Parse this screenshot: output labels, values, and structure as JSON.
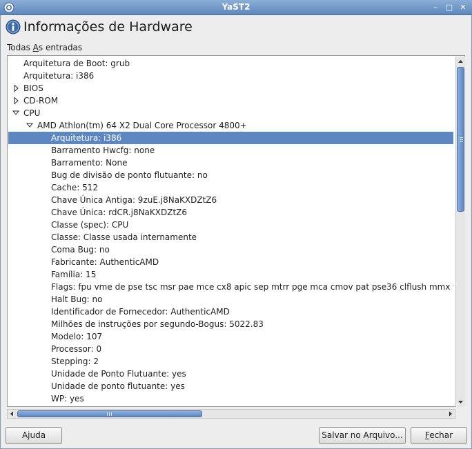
{
  "window": {
    "title": "YaST2",
    "controls": {
      "minimize": "–",
      "maximize": "□",
      "close": "✕"
    }
  },
  "heading": {
    "title": "Informações de Hardware"
  },
  "tree": {
    "label_prefix": "Todas ",
    "label_mnemonic": "A",
    "label_suffix": "s entradas",
    "rows": [
      {
        "text": "Arquitetura de Boot: grub",
        "level": 1,
        "expander": "none"
      },
      {
        "text": "Arquitetura: i386",
        "level": 1,
        "expander": "none"
      },
      {
        "text": "BIOS",
        "level": 1,
        "expander": "collapsed"
      },
      {
        "text": "CD-ROM",
        "level": 1,
        "expander": "collapsed"
      },
      {
        "text": "CPU",
        "level": 1,
        "expander": "expanded"
      },
      {
        "text": "AMD Athlon(tm) 64 X2 Dual Core Processor 4800+",
        "level": 2,
        "expander": "expanded"
      },
      {
        "text": "Arquitetura: i386",
        "level": 3,
        "expander": "none",
        "selected": true
      },
      {
        "text": "Barramento Hwcfg: none",
        "level": 3,
        "expander": "none"
      },
      {
        "text": "Barramento: None",
        "level": 3,
        "expander": "none"
      },
      {
        "text": "Bug de divisão de ponto flutuante: no",
        "level": 3,
        "expander": "none"
      },
      {
        "text": "Cache: 512",
        "level": 3,
        "expander": "none"
      },
      {
        "text": "Chave Única Antiga: 9zuE.j8NaKXDZtZ6",
        "level": 3,
        "expander": "none"
      },
      {
        "text": "Chave Única: rdCR.j8NaKXDZtZ6",
        "level": 3,
        "expander": "none"
      },
      {
        "text": "Classe (spec): CPU",
        "level": 3,
        "expander": "none"
      },
      {
        "text": "Classe: Classe usada internamente",
        "level": 3,
        "expander": "none"
      },
      {
        "text": "Coma Bug: no",
        "level": 3,
        "expander": "none"
      },
      {
        "text": "Fabricante: AuthenticAMD",
        "level": 3,
        "expander": "none"
      },
      {
        "text": "Família: 15",
        "level": 3,
        "expander": "none"
      },
      {
        "text": "Flags: fpu vme de pse tsc msr pae mce cx8 apic sep mtrr pge mca cmov pat pse36 clflush mmx fxsr",
        "level": 3,
        "expander": "none"
      },
      {
        "text": "Halt Bug: no",
        "level": 3,
        "expander": "none"
      },
      {
        "text": "Identificador de Fornecedor: AuthenticAMD",
        "level": 3,
        "expander": "none"
      },
      {
        "text": "Milhões de instruções por segundo-Bogus: 5022.83",
        "level": 3,
        "expander": "none"
      },
      {
        "text": "Modelo: 107",
        "level": 3,
        "expander": "none"
      },
      {
        "text": "Processor: 0",
        "level": 3,
        "expander": "none"
      },
      {
        "text": "Stepping: 2",
        "level": 3,
        "expander": "none"
      },
      {
        "text": "Unidade de Ponto Flutuante: yes",
        "level": 3,
        "expander": "none"
      },
      {
        "text": "Unidade de ponto flutuante: yes",
        "level": 3,
        "expander": "none"
      },
      {
        "text": "WP: yes",
        "level": 3,
        "expander": "none"
      }
    ]
  },
  "buttons": {
    "help": "Ajuda",
    "save": "Salvar no Arquivo...",
    "close_mnemonic": "F",
    "close_rest": "echar"
  },
  "colors": {
    "selection": "#5c87c2",
    "titlebar": "#5f87bb"
  }
}
